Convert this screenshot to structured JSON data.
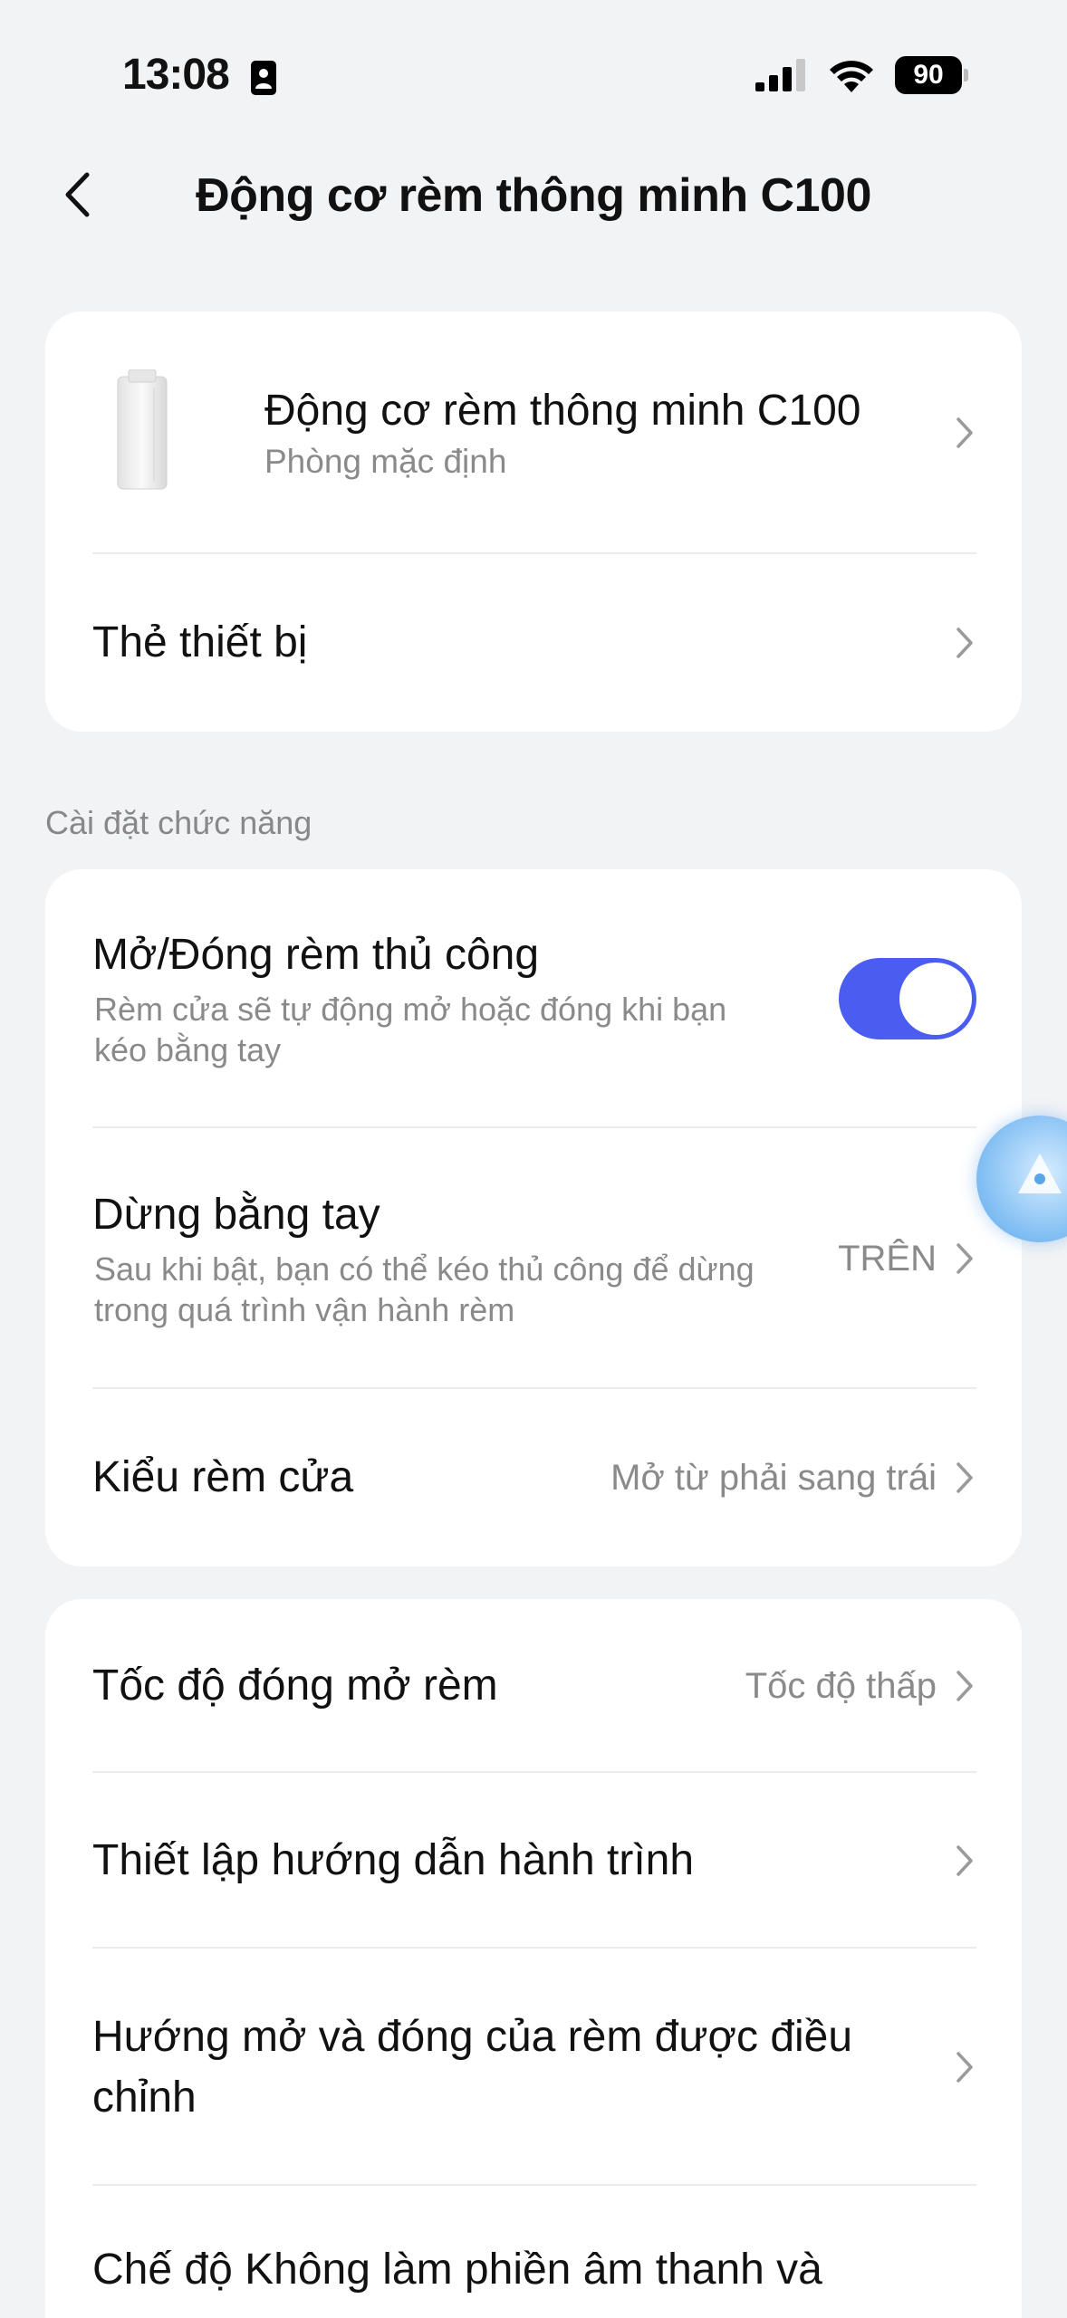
{
  "status_bar": {
    "time": "13:08",
    "battery": "90"
  },
  "header": {
    "title": "Động cơ rèm thông minh C100"
  },
  "device_card": {
    "name": "Động cơ rèm thông minh C100",
    "room": "Phòng mặc định",
    "device_tag_label": "Thẻ thiết bị"
  },
  "function_section": {
    "label": "Cài đặt chức năng",
    "manual_open": {
      "title": "Mở/Đóng rèm thủ công",
      "desc": "Rèm cửa sẽ tự động mở hoặc đóng khi bạn kéo bằng tay",
      "enabled": true
    },
    "manual_stop": {
      "title": "Dừng bằng tay",
      "desc": "Sau khi bật, bạn có thể kéo thủ công để dừng trong quá trình vận hành rèm",
      "value": "TRÊN"
    },
    "curtain_type": {
      "title": "Kiểu rèm cửa",
      "value": "Mở từ phải sang trái"
    }
  },
  "settings_card": {
    "speed": {
      "title": "Tốc độ đóng mở rèm",
      "value": "Tốc độ thấp"
    },
    "travel_guide": {
      "title": "Thiết lập hướng dẫn hành trình"
    },
    "direction": {
      "title": "Hướng mở và đóng của rèm được điều chỉnh"
    },
    "dnd": {
      "title": "Chế độ Không làm phiền âm thanh và"
    }
  },
  "colors": {
    "accent": "#4a5df0",
    "background": "#f2f3f5",
    "card": "#ffffff",
    "secondary_text": "#8a8a8a"
  }
}
